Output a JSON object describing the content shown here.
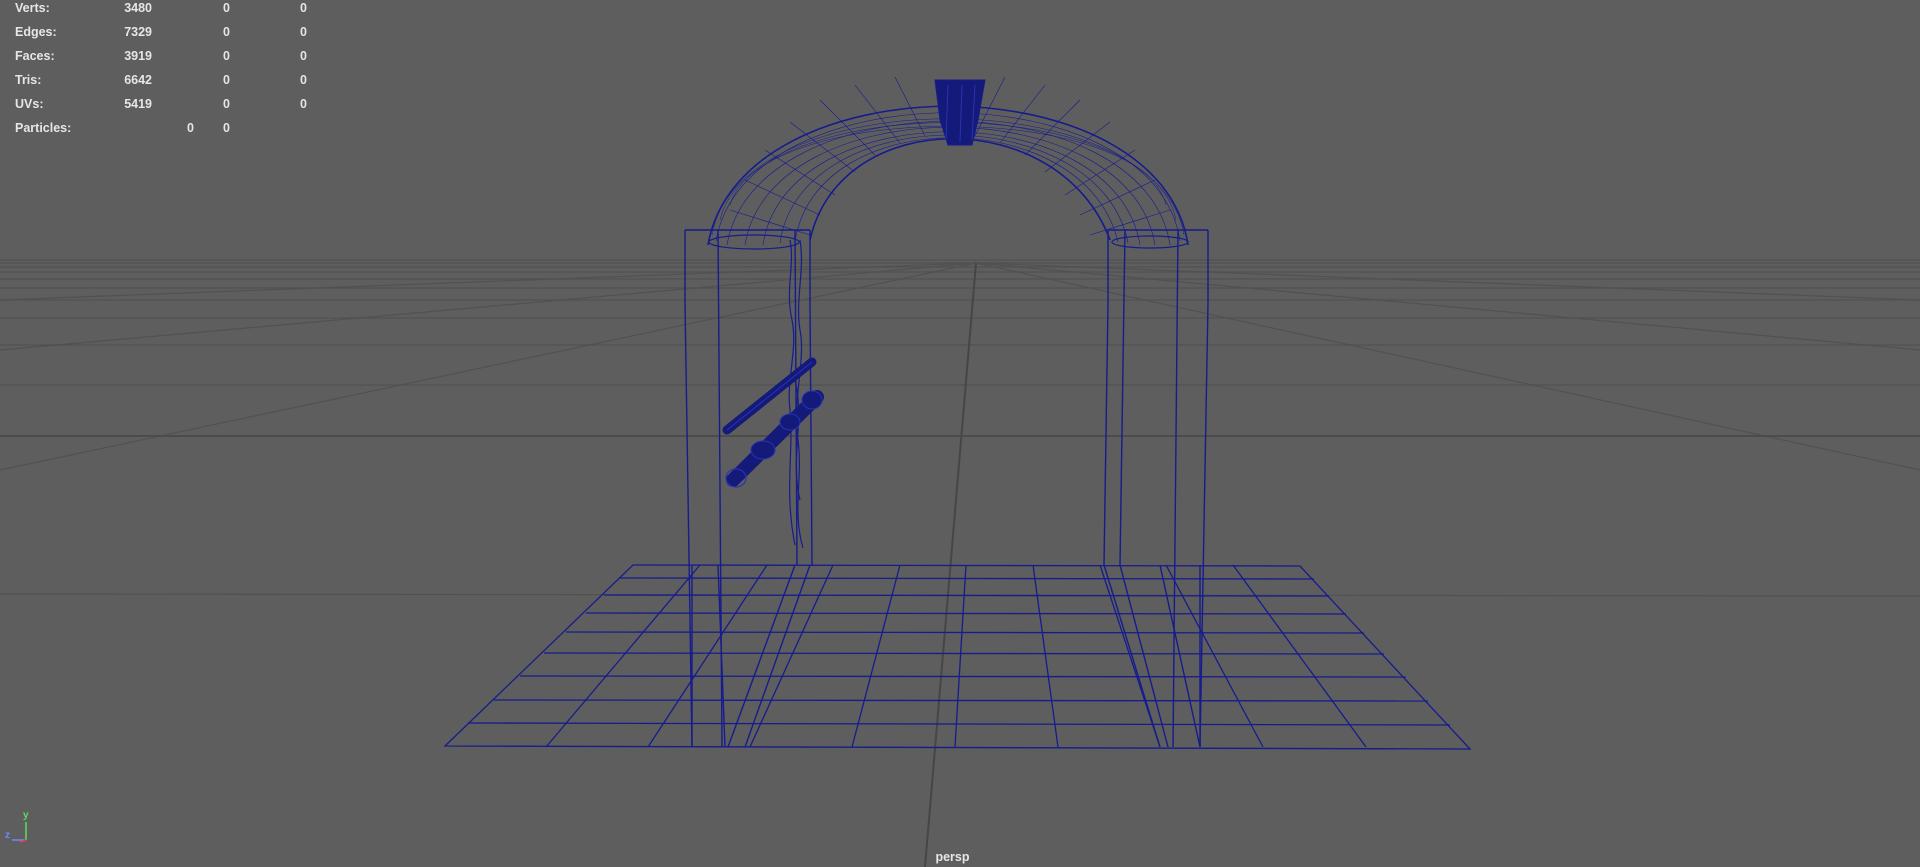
{
  "hud": {
    "rows": [
      {
        "label": "Verts:",
        "total": "3480",
        "selected": "0",
        "components": "0"
      },
      {
        "label": "Edges:",
        "total": "7329",
        "selected": "0",
        "components": "0"
      },
      {
        "label": "Faces:",
        "total": "3919",
        "selected": "0",
        "components": "0"
      },
      {
        "label": "Tris:",
        "total": "6642",
        "selected": "0",
        "components": "0"
      },
      {
        "label": "UVs:",
        "total": "5419",
        "selected": "0",
        "components": "0"
      }
    ],
    "particles": {
      "label": "Particles:",
      "total": "0",
      "selected": "0"
    }
  },
  "camera": {
    "name": "persp"
  },
  "axis": {
    "y": "y",
    "z": "z"
  },
  "colors": {
    "background": "#5e5e5e",
    "grid": "#505050",
    "wireframe": "#141a8a",
    "hud_text": "#e6e6e6"
  }
}
